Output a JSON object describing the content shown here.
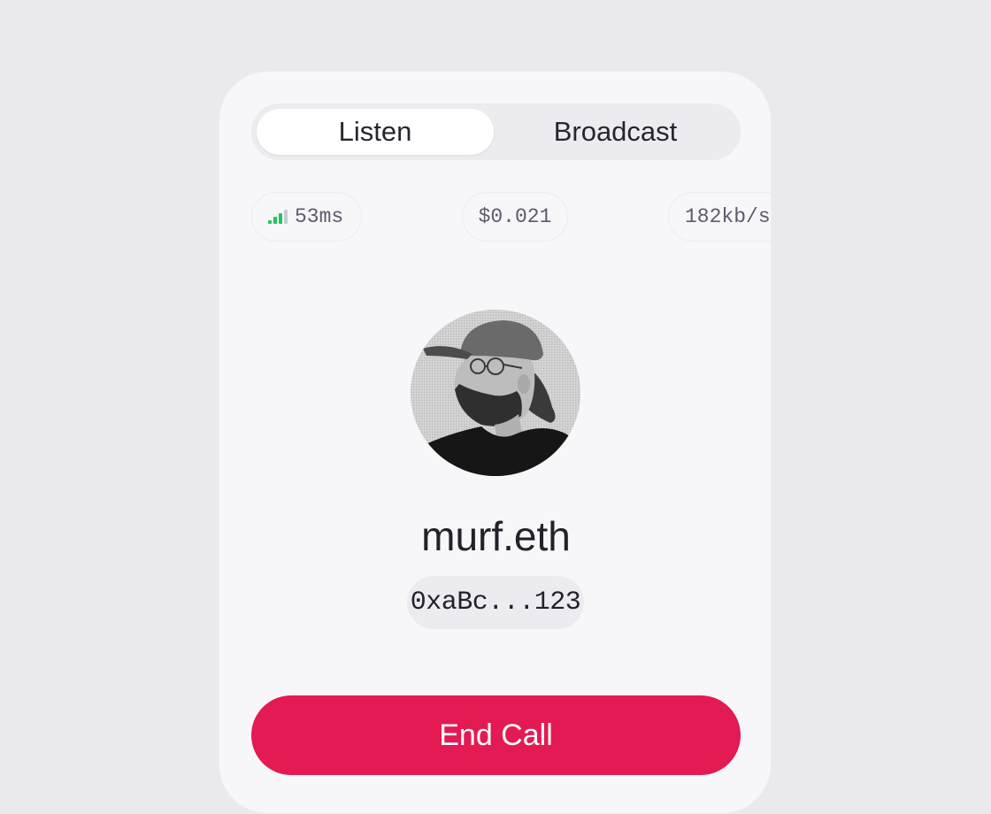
{
  "tabs": {
    "listen_label": "Listen",
    "broadcast_label": "Broadcast",
    "active": "Listen"
  },
  "stats": {
    "latency": "53ms",
    "cost": "$0.021",
    "bitrate": "182kb/s"
  },
  "colors": {
    "signal_green": "#22c55e",
    "end_call": "#e41a53"
  },
  "profile": {
    "name": "murf.eth",
    "address": "0xaBc...123"
  },
  "actions": {
    "end_call_label": "End Call"
  }
}
